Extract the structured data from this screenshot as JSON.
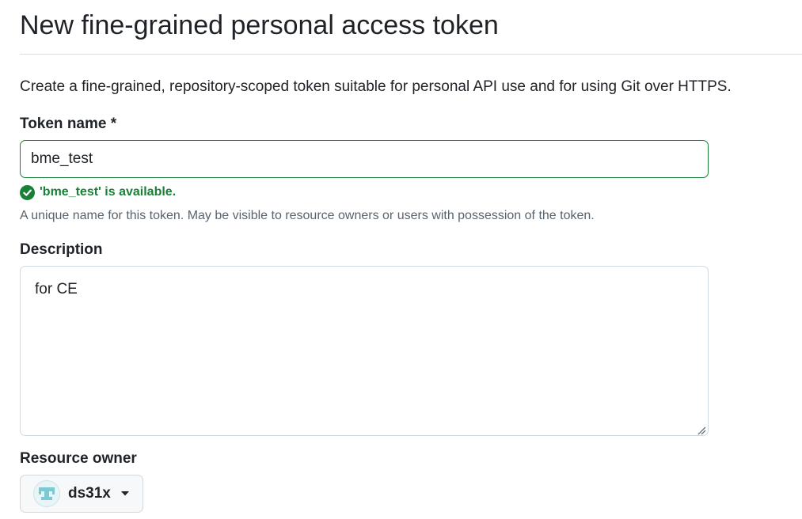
{
  "page": {
    "title": "New fine-grained personal access token",
    "intro": "Create a fine-grained, repository-scoped token suitable for personal API use and for using Git over HTTPS."
  },
  "token_name": {
    "label": "Token name *",
    "value": "bme_test",
    "validation_message": "'bme_test' is available.",
    "validation_icon": "check-circle-fill-icon",
    "hint": "A unique name for this token. May be visible to resource owners or users with possession of the token."
  },
  "description": {
    "label": "Description",
    "value": "for CE"
  },
  "resource_owner": {
    "label": "Resource owner",
    "selected": "ds31x",
    "avatar_icon": "identicon-avatar",
    "dropdown_icon": "caret-down-icon"
  },
  "colors": {
    "success": "#1a7f37",
    "border": "#d1d9e0",
    "muted_text": "#59636e",
    "button_bg": "#f6f8fa",
    "avatar_accent": "#7cc9d4"
  }
}
